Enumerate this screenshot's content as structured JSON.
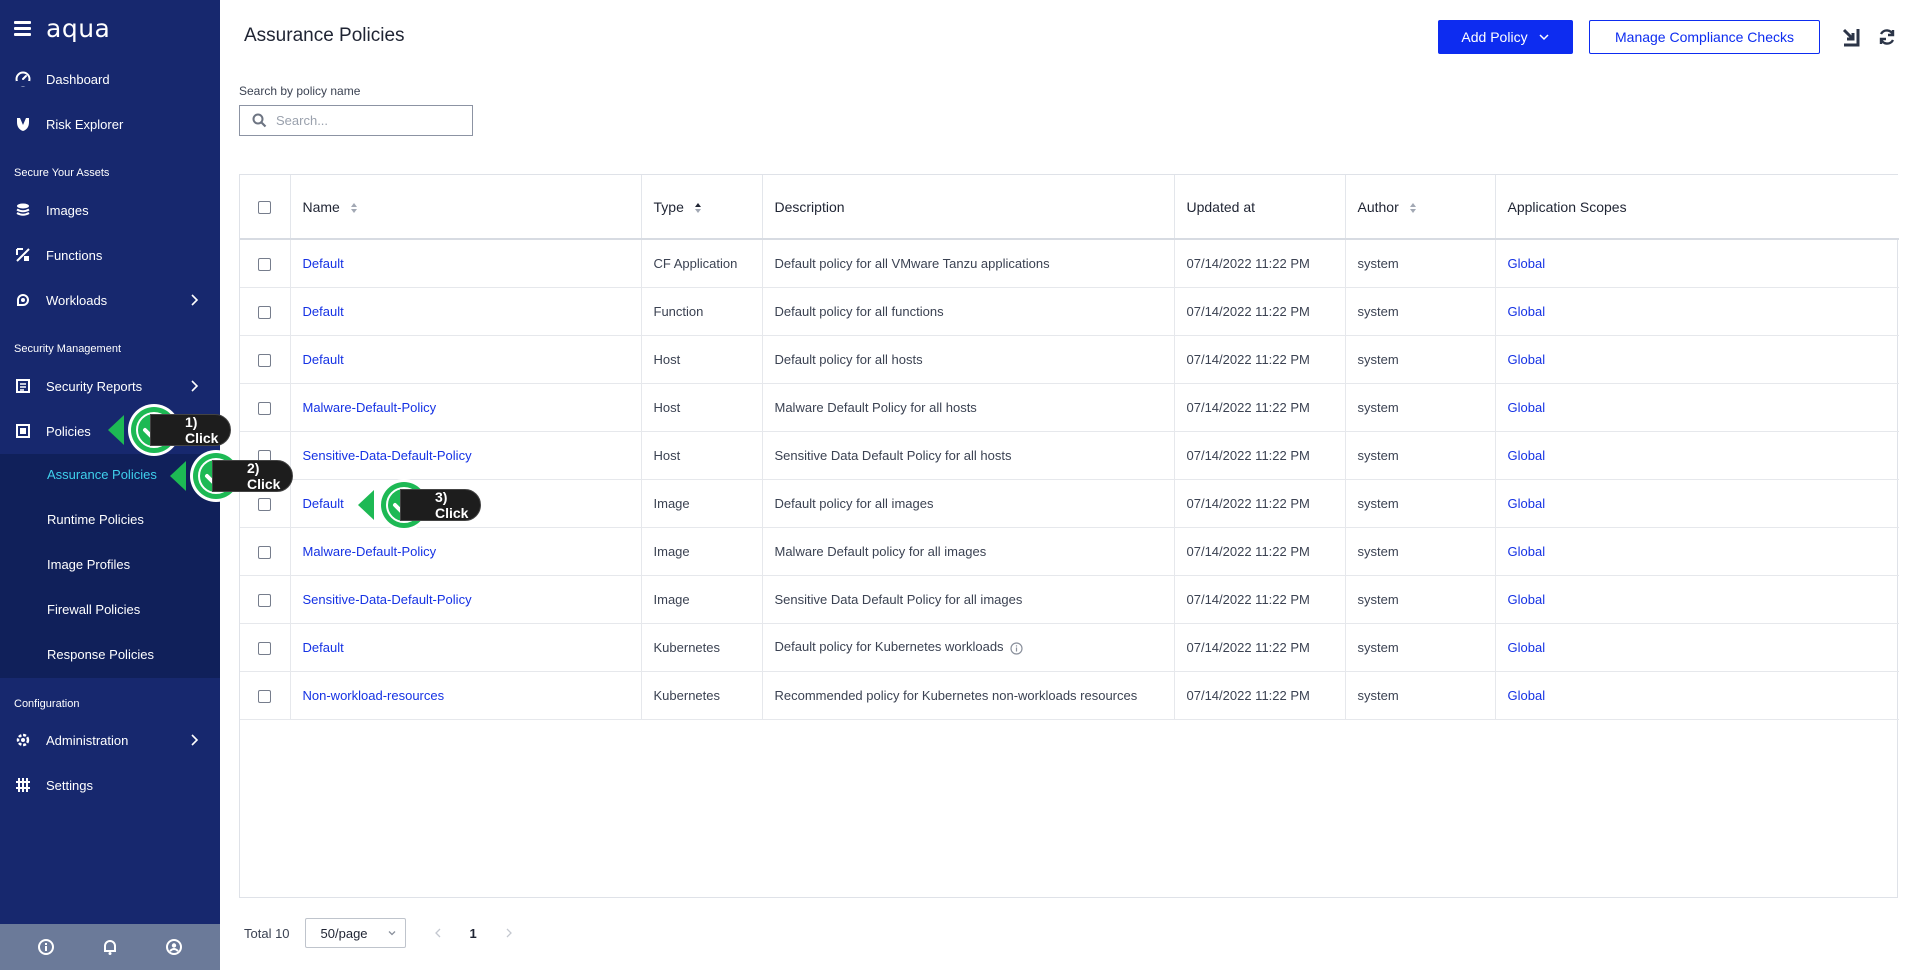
{
  "app": {
    "brand": "aqua"
  },
  "sidebar": {
    "top_items": [
      {
        "label": "Dashboard",
        "icon": "gauge-icon"
      },
      {
        "label": "Risk Explorer",
        "icon": "risk-explorer-icon"
      }
    ],
    "section_secure": "Secure Your Assets",
    "secure_items": [
      {
        "label": "Images",
        "icon": "layers-icon"
      },
      {
        "label": "Functions",
        "icon": "functions-icon"
      },
      {
        "label": "Workloads",
        "icon": "workloads-icon"
      }
    ],
    "section_security": "Security Management",
    "security_items": [
      {
        "label": "Security Reports",
        "icon": "reports-icon"
      },
      {
        "label": "Policies",
        "icon": "policies-icon"
      }
    ],
    "policies_sub": [
      {
        "label": "Assurance Policies",
        "active": true
      },
      {
        "label": "Runtime Policies",
        "active": false
      },
      {
        "label": "Image Profiles",
        "active": false
      },
      {
        "label": "Firewall Policies",
        "active": false
      },
      {
        "label": "Response Policies",
        "active": false
      }
    ],
    "section_config": "Configuration",
    "config_items": [
      {
        "label": "Administration",
        "icon": "gear-icon"
      },
      {
        "label": "Settings",
        "icon": "settings-grid-icon"
      }
    ],
    "footer_icons": [
      "info-icon",
      "bell-icon",
      "user-icon"
    ]
  },
  "header": {
    "title": "Assurance Policies",
    "add_policy": "Add Policy",
    "manage_compliance": "Manage Compliance Checks"
  },
  "search": {
    "label": "Search by policy name",
    "placeholder": "Search..."
  },
  "table": {
    "columns": [
      "Name",
      "Type",
      "Description",
      "Updated at",
      "Author",
      "Application Scopes"
    ],
    "sort": {
      "Name": "none",
      "Type": "ascending",
      "Author": "none"
    },
    "rows": [
      {
        "name": "Default",
        "type": "CF Application",
        "description": "Default policy for all VMware Tanzu applications",
        "updated": "07/14/2022 11:22 PM",
        "author": "system",
        "scope": "Global"
      },
      {
        "name": "Default",
        "type": "Function",
        "description": "Default policy for all functions",
        "updated": "07/14/2022 11:22 PM",
        "author": "system",
        "scope": "Global"
      },
      {
        "name": "Default",
        "type": "Host",
        "description": "Default policy for all hosts",
        "updated": "07/14/2022 11:22 PM",
        "author": "system",
        "scope": "Global"
      },
      {
        "name": "Malware-Default-Policy",
        "type": "Host",
        "description": "Malware Default Policy for all hosts",
        "updated": "07/14/2022 11:22 PM",
        "author": "system",
        "scope": "Global"
      },
      {
        "name": "Sensitive-Data-Default-Policy",
        "type": "Host",
        "description": "Sensitive Data Default Policy for all hosts",
        "updated": "07/14/2022 11:22 PM",
        "author": "system",
        "scope": "Global"
      },
      {
        "name": "Default",
        "type": "Image",
        "description": "Default policy for all images",
        "updated": "07/14/2022 11:22 PM",
        "author": "system",
        "scope": "Global"
      },
      {
        "name": "Malware-Default-Policy",
        "type": "Image",
        "description": "Malware Default policy for all images",
        "updated": "07/14/2022 11:22 PM",
        "author": "system",
        "scope": "Global"
      },
      {
        "name": "Sensitive-Data-Default-Policy",
        "type": "Image",
        "description": "Sensitive Data Default Policy for all images",
        "updated": "07/14/2022 11:22 PM",
        "author": "system",
        "scope": "Global"
      },
      {
        "name": "Default",
        "type": "Kubernetes",
        "description": "Default policy for Kubernetes workloads",
        "updated": "07/14/2022 11:22 PM",
        "author": "system",
        "scope": "Global",
        "info": true
      },
      {
        "name": "Non-workload-resources",
        "type": "Kubernetes",
        "description": "Recommended policy for Kubernetes non-workloads resources",
        "updated": "07/14/2022 11:22 PM",
        "author": "system",
        "scope": "Global"
      }
    ]
  },
  "pagination": {
    "total": "Total 10",
    "page_size": "50/page",
    "current_page": "1"
  },
  "callouts": [
    "1) Click",
    "2) Click",
    "3) Click"
  ],
  "colors": {
    "sidebar_bg": "#17286e",
    "sidebar_sub_bg": "#10205a",
    "active_text": "#3fd0ec",
    "primary": "#0d2cf0",
    "link": "#1532e4",
    "callout_green": "#1db954"
  }
}
